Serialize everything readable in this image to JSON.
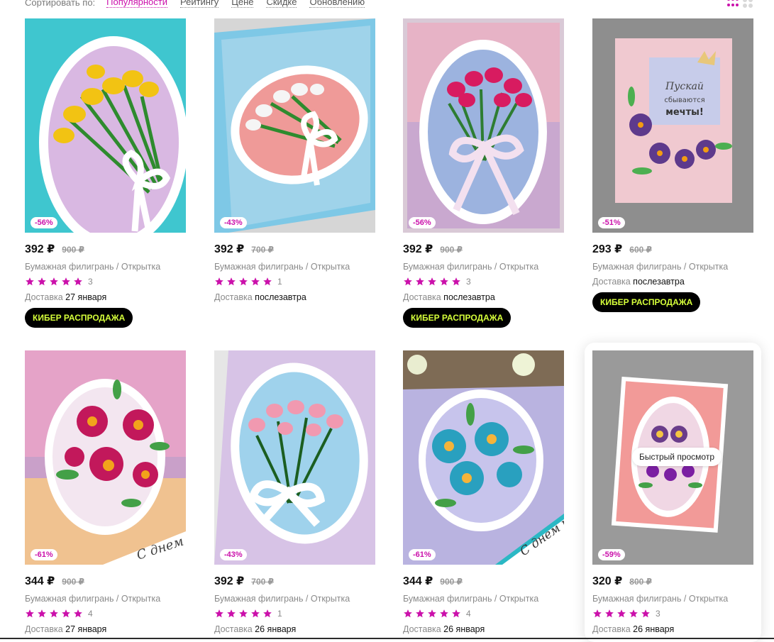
{
  "sort": {
    "label": "Сортировать по:",
    "options": [
      "Популярности",
      "Рейтингу",
      "Цене",
      "Скидке",
      "Обновлению"
    ],
    "active": "Популярности"
  },
  "colors": {
    "accent": "#cb11ab",
    "promo_bg": "#000000",
    "promo_text": "#d6ff3a"
  },
  "products": [
    {
      "discount": "-56%",
      "price": "392 ₽",
      "old_price": "900 ₽",
      "name": "Бумажная филигрань / Открытка",
      "rating": 5,
      "reviews": "3",
      "delivery_label": "Доставка",
      "delivery_date": "27 января",
      "promo": "КИБЕР РАСПРОДАЖА"
    },
    {
      "discount": "-43%",
      "price": "392 ₽",
      "old_price": "700 ₽",
      "name": "Бумажная филигрань / Открытка",
      "rating": 5,
      "reviews": "1",
      "delivery_label": "Доставка",
      "delivery_date": "послезавтра",
      "promo": ""
    },
    {
      "discount": "-56%",
      "price": "392 ₽",
      "old_price": "900 ₽",
      "name": "Бумажная филигрань / Открытка",
      "rating": 5,
      "reviews": "3",
      "delivery_label": "Доставка",
      "delivery_date": "послезавтра",
      "promo": "КИБЕР РАСПРОДАЖА"
    },
    {
      "discount": "-51%",
      "price": "293 ₽",
      "old_price": "600 ₽",
      "name": "Бумажная филигрань / Открытка",
      "rating": 0,
      "reviews": "",
      "delivery_label": "Доставка",
      "delivery_date": "послезавтра",
      "promo": "КИБЕР РАСПРОДАЖА"
    },
    {
      "discount": "-61%",
      "price": "344 ₽",
      "old_price": "900 ₽",
      "name": "Бумажная филигрань / Открытка",
      "rating": 5,
      "reviews": "4",
      "delivery_label": "Доставка",
      "delivery_date": "27 января",
      "promo": ""
    },
    {
      "discount": "-43%",
      "price": "392 ₽",
      "old_price": "700 ₽",
      "name": "Бумажная филигрань / Открытка",
      "rating": 5,
      "reviews": "1",
      "delivery_label": "Доставка",
      "delivery_date": "26 января",
      "promo": ""
    },
    {
      "discount": "-61%",
      "price": "344 ₽",
      "old_price": "900 ₽",
      "name": "Бумажная филигрань / Открытка",
      "rating": 5,
      "reviews": "4",
      "delivery_label": "Доставка",
      "delivery_date": "26 января",
      "promo": ""
    },
    {
      "discount": "-59%",
      "price": "320 ₽",
      "old_price": "800 ₽",
      "name": "Бумажная филигрань / Открытка",
      "rating": 5,
      "reviews": "3",
      "delivery_label": "Доставка",
      "delivery_date": "26 января",
      "promo": "",
      "quick_view": "Быстрый просмотр"
    }
  ]
}
